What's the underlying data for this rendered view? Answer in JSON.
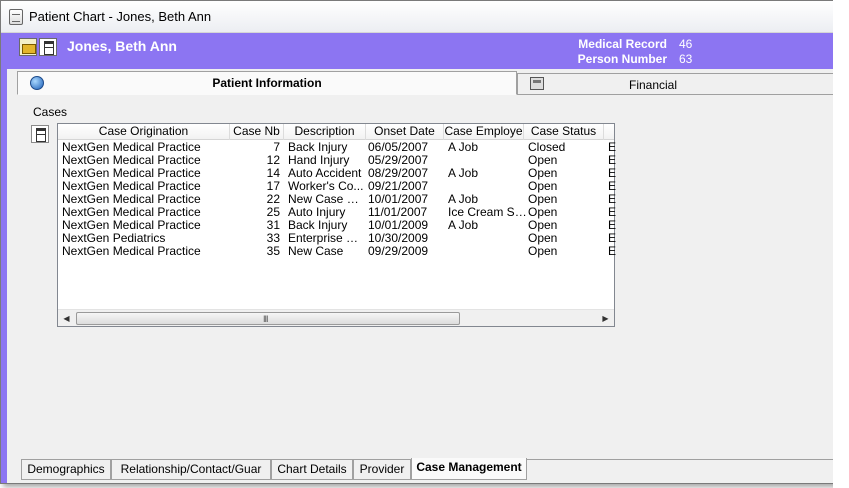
{
  "window": {
    "title": "Patient Chart - Jones, Beth Ann"
  },
  "header": {
    "patient_name": "Jones, Beth Ann",
    "medical_record_label": "Medical Record",
    "medical_record_value": "46",
    "person_number_label": "Person Number",
    "person_number_value": "63",
    "accent_color": "#8c75f2"
  },
  "top_tabs": [
    {
      "label": "Patient Information",
      "icon": "globe-icon",
      "active": true
    },
    {
      "label": "Financial",
      "icon": "calculator-icon",
      "active": false
    }
  ],
  "cases": {
    "label": "Cases",
    "columns": [
      "Case Origination",
      "Case Nb",
      "Description",
      "Onset Date",
      "Case Employe",
      "Case Status"
    ],
    "rows": [
      {
        "origination": "NextGen Medical Practice",
        "nb": "7",
        "description": "Back Injury",
        "onset": "06/05/2007",
        "employer": "A Job",
        "status": "Closed",
        "extra": "E"
      },
      {
        "origination": "NextGen Medical Practice",
        "nb": "12",
        "description": "Hand Injury",
        "onset": "05/29/2007",
        "employer": "",
        "status": "Open",
        "extra": "E"
      },
      {
        "origination": "NextGen Medical Practice",
        "nb": "14",
        "description": "Auto Accident",
        "onset": "08/29/2007",
        "employer": "A Job",
        "status": "Open",
        "extra": "E"
      },
      {
        "origination": "NextGen Medical Practice",
        "nb": "17",
        "description": "Worker's Co...",
        "onset": "09/21/2007",
        "employer": "",
        "status": "Open",
        "extra": "E"
      },
      {
        "origination": "NextGen Medical Practice",
        "nb": "22",
        "description": "New Case De...",
        "onset": "10/01/2007",
        "employer": "A Job",
        "status": "Open",
        "extra": "E"
      },
      {
        "origination": "NextGen Medical Practice",
        "nb": "25",
        "description": "Auto Injury",
        "onset": "11/01/2007",
        "employer": "Ice Cream Sh...",
        "status": "Open",
        "extra": "E"
      },
      {
        "origination": "NextGen Medical Practice",
        "nb": "31",
        "description": "Back Injury",
        "onset": "10/01/2009",
        "employer": "A Job",
        "status": "Open",
        "extra": "E"
      },
      {
        "origination": "NextGen Pediatrics",
        "nb": "33",
        "description": "Enterprise Ca...",
        "onset": "10/30/2009",
        "employer": "",
        "status": "Open",
        "extra": "E"
      },
      {
        "origination": "NextGen Medical Practice",
        "nb": "35",
        "description": "New Case",
        "onset": "09/29/2009",
        "employer": "",
        "status": "Open",
        "extra": "E"
      }
    ],
    "scroll_grip": "III"
  },
  "bottom_tabs": [
    {
      "label": "Demographics",
      "active": false
    },
    {
      "label": "Relationship/Contact/Guar",
      "active": false
    },
    {
      "label": "Chart Details",
      "active": false
    },
    {
      "label": "Provider",
      "active": false
    },
    {
      "label": "Case Management",
      "active": true
    }
  ]
}
